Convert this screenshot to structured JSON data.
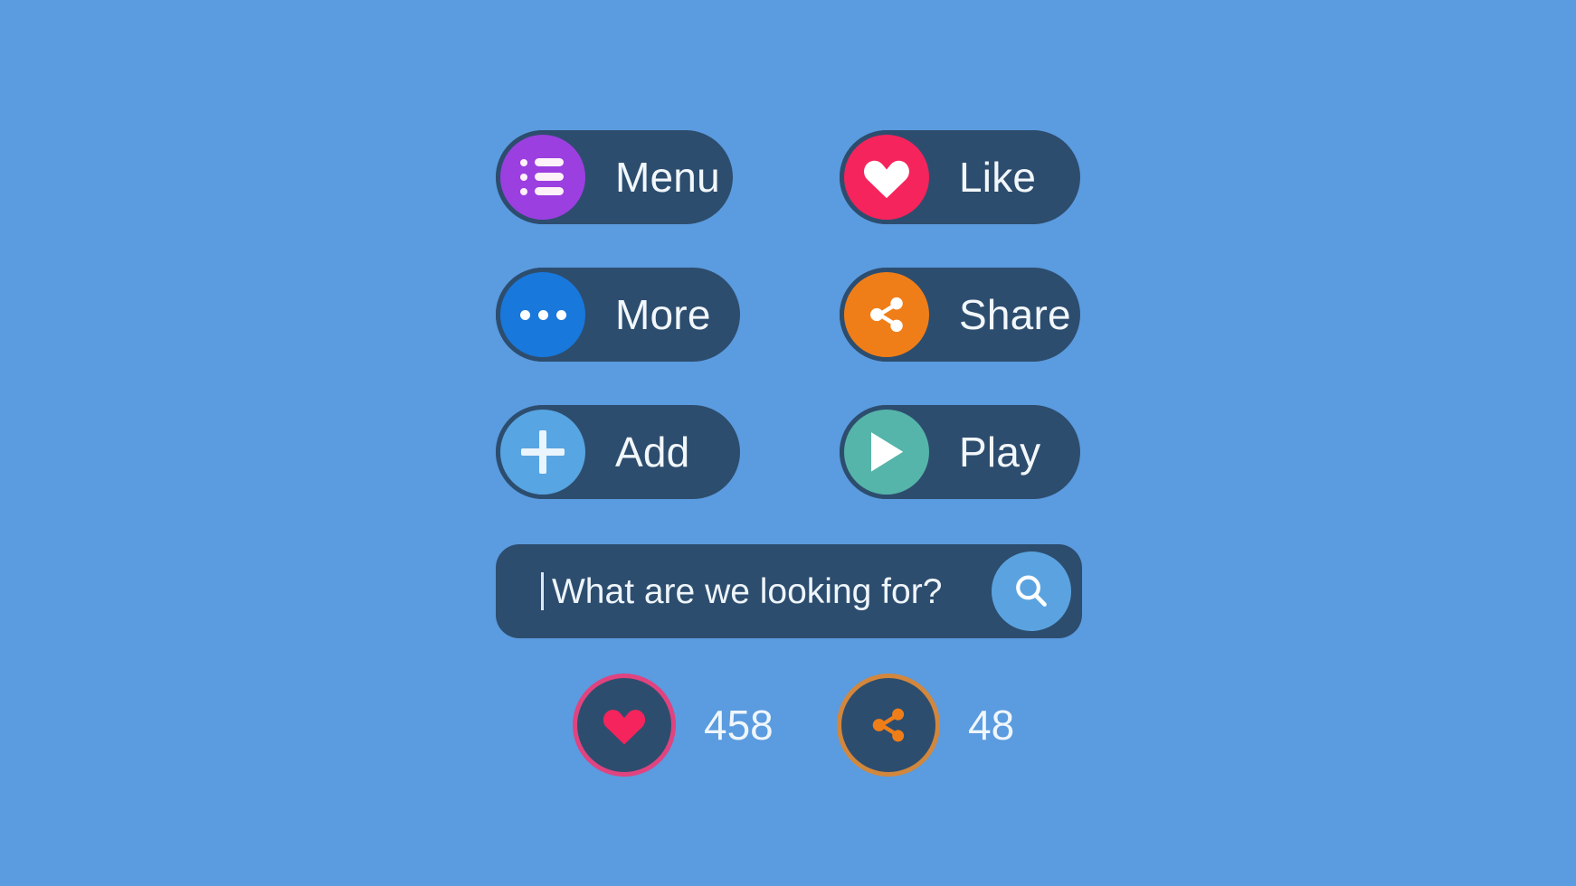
{
  "theme": {
    "background": "#5b9bdf",
    "button_fill": "#2d4d6e",
    "label_color": "#f2f7fb"
  },
  "buttons": [
    {
      "id": "menu",
      "label": "Menu",
      "icon": "list-menu-icon",
      "icon_color": "#9b3fe0",
      "icon_glyph_color": "#fdf2f8"
    },
    {
      "id": "like",
      "label": "Like",
      "icon": "heart-icon",
      "icon_color": "#f5245c",
      "icon_glyph_color": "#ffffff"
    },
    {
      "id": "more",
      "label": "More",
      "icon": "ellipsis-icon",
      "icon_color": "#1878dc",
      "icon_glyph_color": "#ffffff"
    },
    {
      "id": "share",
      "label": "Share",
      "icon": "share-nodes-icon",
      "icon_color": "#f07e18",
      "icon_glyph_color": "#ffffff"
    },
    {
      "id": "add",
      "label": "Add",
      "icon": "plus-icon",
      "icon_color": "#57a5e2",
      "icon_glyph_color": "#eaf4fc"
    },
    {
      "id": "play",
      "label": "Play",
      "icon": "play-triangle-icon",
      "icon_color": "#55b5aa",
      "icon_glyph_color": "#ffffff"
    }
  ],
  "search": {
    "placeholder": "What are we looking for?",
    "value": "",
    "button_icon": "magnifier-icon",
    "button_color": "#5aa3e0"
  },
  "counters": [
    {
      "id": "likes",
      "count": "458",
      "icon": "heart-icon",
      "ring_color": "#e0437f",
      "glyph_color": "#f5245c"
    },
    {
      "id": "shares",
      "count": "48",
      "icon": "share-nodes-icon",
      "ring_color": "#d2873c",
      "glyph_color": "#f07e18"
    }
  ]
}
